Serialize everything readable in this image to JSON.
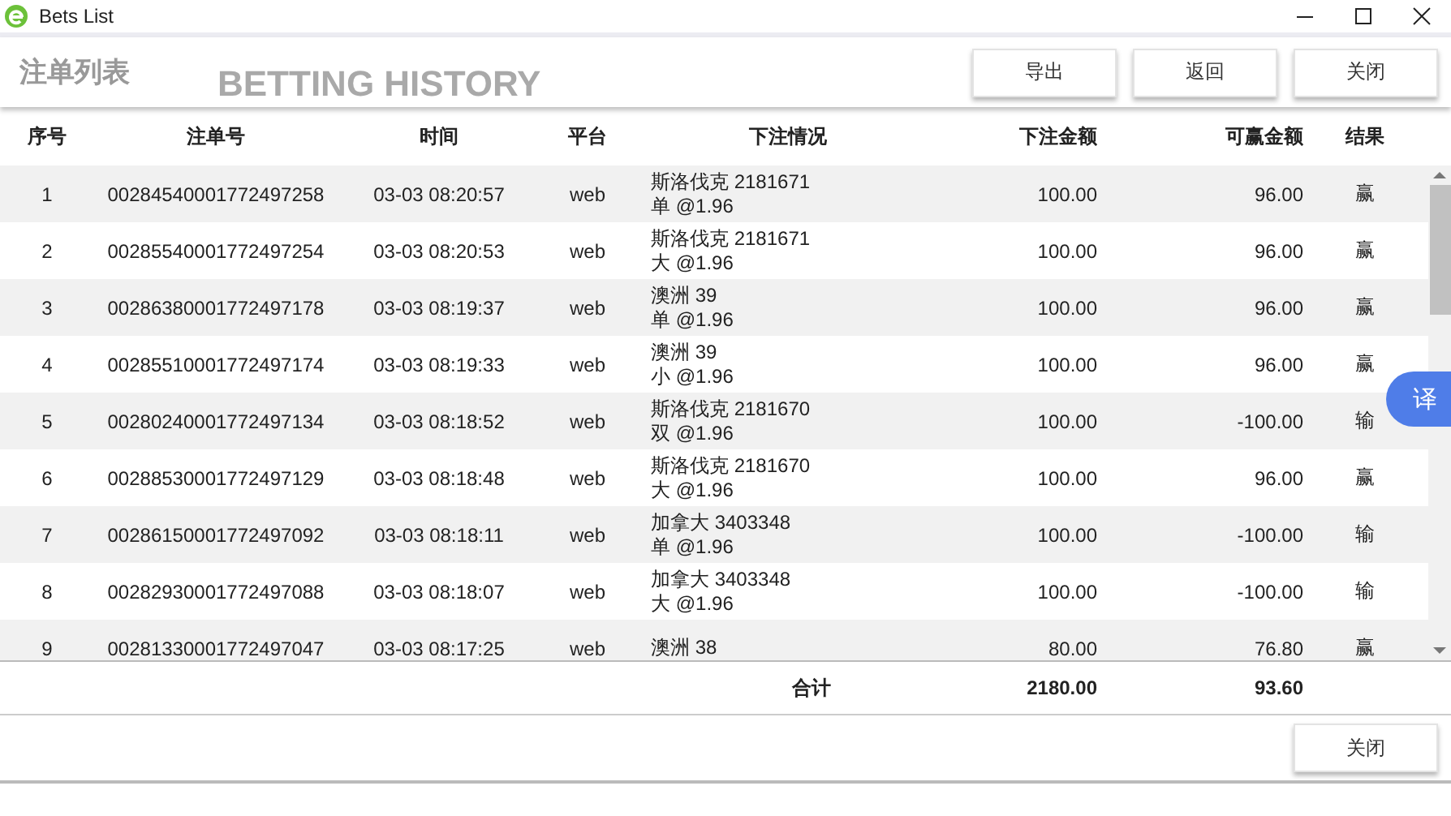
{
  "window": {
    "title": "Bets List"
  },
  "header": {
    "title": "注单列表",
    "subtitle": "BETTING HISTORY",
    "buttons": [
      "导出",
      "返回",
      "关闭"
    ]
  },
  "table": {
    "columns": [
      "序号",
      "注单号",
      "时间",
      "平台",
      "下注情况",
      "下注金额",
      "可赢金额",
      "结果"
    ],
    "rows": [
      {
        "no": "1",
        "order": "00284540001772497258",
        "time": "03-03 08:20:57",
        "platform": "web",
        "detail": [
          "斯洛伐克 2181671",
          "单 @1.96"
        ],
        "amount": "100.00",
        "win": "96.00",
        "result": "赢"
      },
      {
        "no": "2",
        "order": "00285540001772497254",
        "time": "03-03 08:20:53",
        "platform": "web",
        "detail": [
          "斯洛伐克 2181671",
          "大 @1.96"
        ],
        "amount": "100.00",
        "win": "96.00",
        "result": "赢"
      },
      {
        "no": "3",
        "order": "00286380001772497178",
        "time": "03-03 08:19:37",
        "platform": "web",
        "detail": [
          "澳洲 39",
          "单 @1.96"
        ],
        "amount": "100.00",
        "win": "96.00",
        "result": "赢"
      },
      {
        "no": "4",
        "order": "00285510001772497174",
        "time": "03-03 08:19:33",
        "platform": "web",
        "detail": [
          "澳洲 39",
          "小 @1.96"
        ],
        "amount": "100.00",
        "win": "96.00",
        "result": "赢"
      },
      {
        "no": "5",
        "order": "00280240001772497134",
        "time": "03-03 08:18:52",
        "platform": "web",
        "detail": [
          "斯洛伐克 2181670",
          "双 @1.96"
        ],
        "amount": "100.00",
        "win": "-100.00",
        "result": "输"
      },
      {
        "no": "6",
        "order": "00288530001772497129",
        "time": "03-03 08:18:48",
        "platform": "web",
        "detail": [
          "斯洛伐克 2181670",
          "大 @1.96"
        ],
        "amount": "100.00",
        "win": "96.00",
        "result": "赢"
      },
      {
        "no": "7",
        "order": "00286150001772497092",
        "time": "03-03 08:18:11",
        "platform": "web",
        "detail": [
          "加拿大 3403348",
          "单 @1.96"
        ],
        "amount": "100.00",
        "win": "-100.00",
        "result": "输"
      },
      {
        "no": "8",
        "order": "00282930001772497088",
        "time": "03-03 08:18:07",
        "platform": "web",
        "detail": [
          "加拿大 3403348",
          "大 @1.96"
        ],
        "amount": "100.00",
        "win": "-100.00",
        "result": "输"
      },
      {
        "no": "9",
        "order": "00281330001772497047",
        "time": "03-03 08:17:25",
        "platform": "web",
        "detail": [
          "澳洲 38"
        ],
        "amount": "80.00",
        "win": "76.80",
        "result": "赢"
      }
    ],
    "totals": {
      "label": "合计",
      "amount": "2180.00",
      "win": "93.60"
    }
  },
  "translate_button": {
    "label": "译"
  },
  "footer": {
    "buttons": [
      "关闭"
    ]
  }
}
